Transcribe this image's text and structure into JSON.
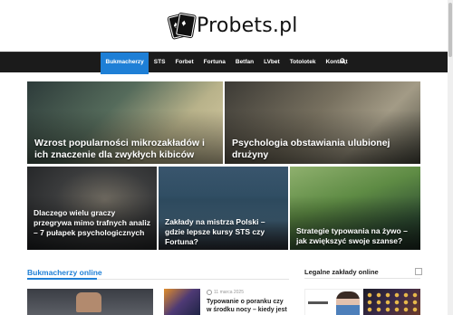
{
  "site": {
    "name": "Probets.pl"
  },
  "nav": {
    "items": [
      "Bukmacherzy",
      "STS",
      "Forbet",
      "Fortuna",
      "Betfan",
      "LVbet",
      "Totolotek",
      "Kontakt"
    ],
    "active": "Bukmacherzy"
  },
  "featured": [
    {
      "title": "Wzrost popularności mikrozakładów i ich znaczenie dla zwykłych kibiców"
    },
    {
      "title": "Psychologia obstawiania ulubionej drużyny"
    },
    {
      "title": "Dlaczego wielu graczy przegrywa mimo trafnych analiz – 7 pułapek psychologicznych"
    },
    {
      "title": "Zakłady na mistrza Polski – gdzie lepsze kursy STS czy Fortuna?"
    },
    {
      "title": "Strategie typowania na żywo – jak zwiększyć swoje szanse?"
    }
  ],
  "sections": {
    "left_heading": "Bukmacherzy online",
    "right_heading": "Legalne zakłady online"
  },
  "post": {
    "date": "11 marca 2025",
    "title": "Typowanie o poranku czy w środku nocy – kiedy jest lepiej?"
  },
  "colors": {
    "accent": "#1e7fd6",
    "nav_bg": "#1b1b1b"
  }
}
